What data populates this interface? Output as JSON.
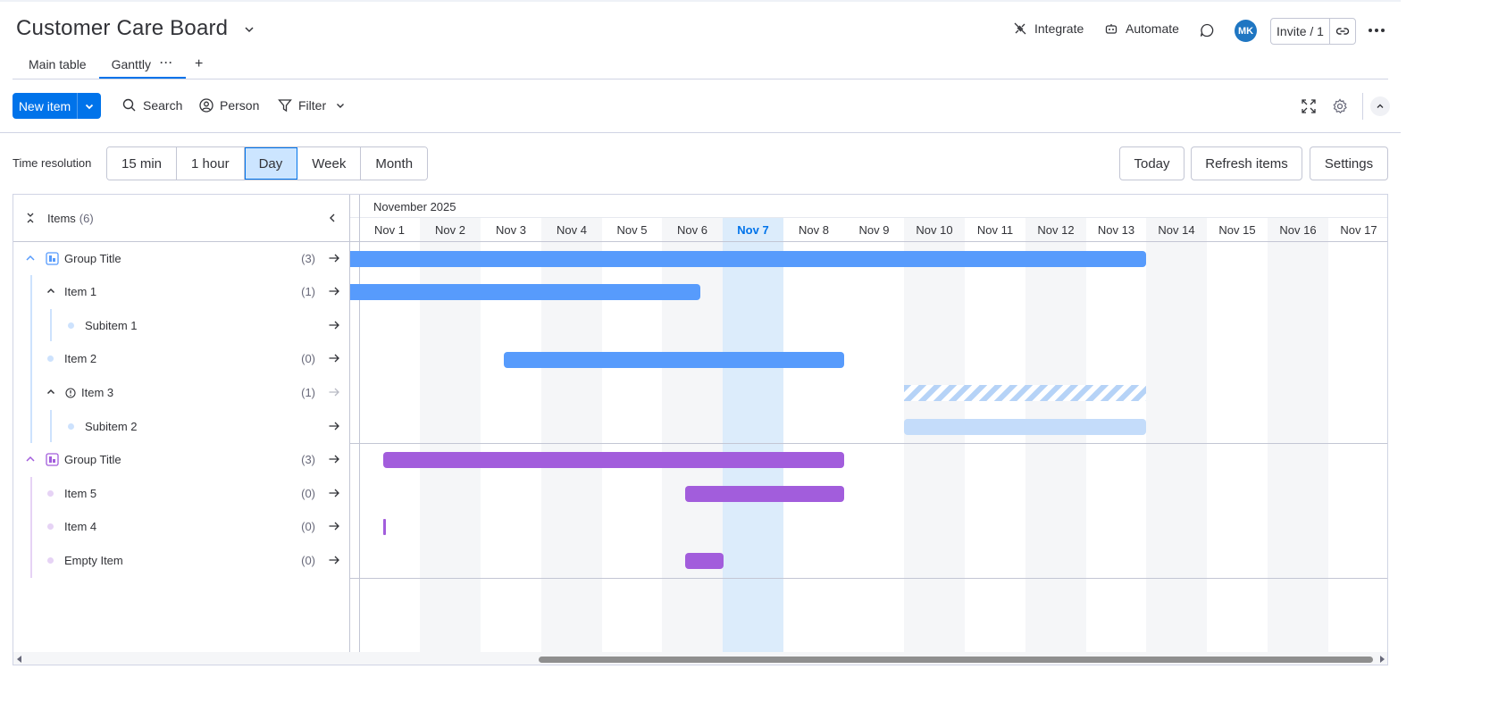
{
  "board": {
    "title": "Customer Care Board"
  },
  "header": {
    "integrate_label": "Integrate",
    "automate_label": "Automate",
    "avatar_initials": "MK",
    "invite_label": "Invite / 1"
  },
  "tabs": [
    {
      "label": "Main table"
    },
    {
      "label": "Ganttly",
      "dots": "···"
    }
  ],
  "tab_add_label": "+",
  "toolbar": {
    "new_item_label": "New item",
    "search_label": "Search",
    "person_label": "Person",
    "filter_label": "Filter"
  },
  "gantt_controls": {
    "time_resolution_label": "Time resolution",
    "resolutions": [
      "15 min",
      "1 hour",
      "Day",
      "Week",
      "Month"
    ],
    "selected_resolution": "Day",
    "today_label": "Today",
    "refresh_label": "Refresh items",
    "settings_label": "Settings"
  },
  "items_panel": {
    "label": "Items",
    "count": "(6)"
  },
  "timeline": {
    "month_label": "November 2025",
    "days": [
      "Nov 1",
      "Nov 2",
      "Nov 3",
      "Nov 4",
      "Nov 5",
      "Nov 6",
      "Nov 7",
      "Nov 8",
      "Nov 9",
      "Nov 10",
      "Nov 11",
      "Nov 12",
      "Nov 13",
      "Nov 14",
      "Nov 15",
      "Nov 16",
      "Nov 17"
    ],
    "today": "Nov 7"
  },
  "groups": [
    {
      "title": "Group Title",
      "count": "(3)",
      "color": "#579bfc",
      "rows": [
        {
          "label": "Item 1",
          "count": "(1)",
          "kind": "parent"
        },
        {
          "label": "Subitem 1",
          "count": "",
          "kind": "subitem"
        },
        {
          "label": "Item 2",
          "count": "(0)",
          "kind": "item"
        },
        {
          "label": "Item 3",
          "count": "(1)",
          "kind": "parent-warning"
        },
        {
          "label": "Subitem 2",
          "count": "",
          "kind": "subitem"
        }
      ]
    },
    {
      "title": "Group Title",
      "count": "(3)",
      "color": "#a25ddc",
      "rows": [
        {
          "label": "Item 5",
          "count": "(0)",
          "kind": "item"
        },
        {
          "label": "Item 4",
          "count": "(0)",
          "kind": "item"
        },
        {
          "label": "Empty Item",
          "count": "(0)",
          "kind": "item"
        }
      ]
    }
  ],
  "colors": {
    "primary": "#0073ea",
    "group1": "#579bfc",
    "group2": "#a25ddc",
    "today_column": "#dcecfb",
    "weekend_column": "#f5f6f8",
    "light_bar": "#c4dcfa"
  }
}
